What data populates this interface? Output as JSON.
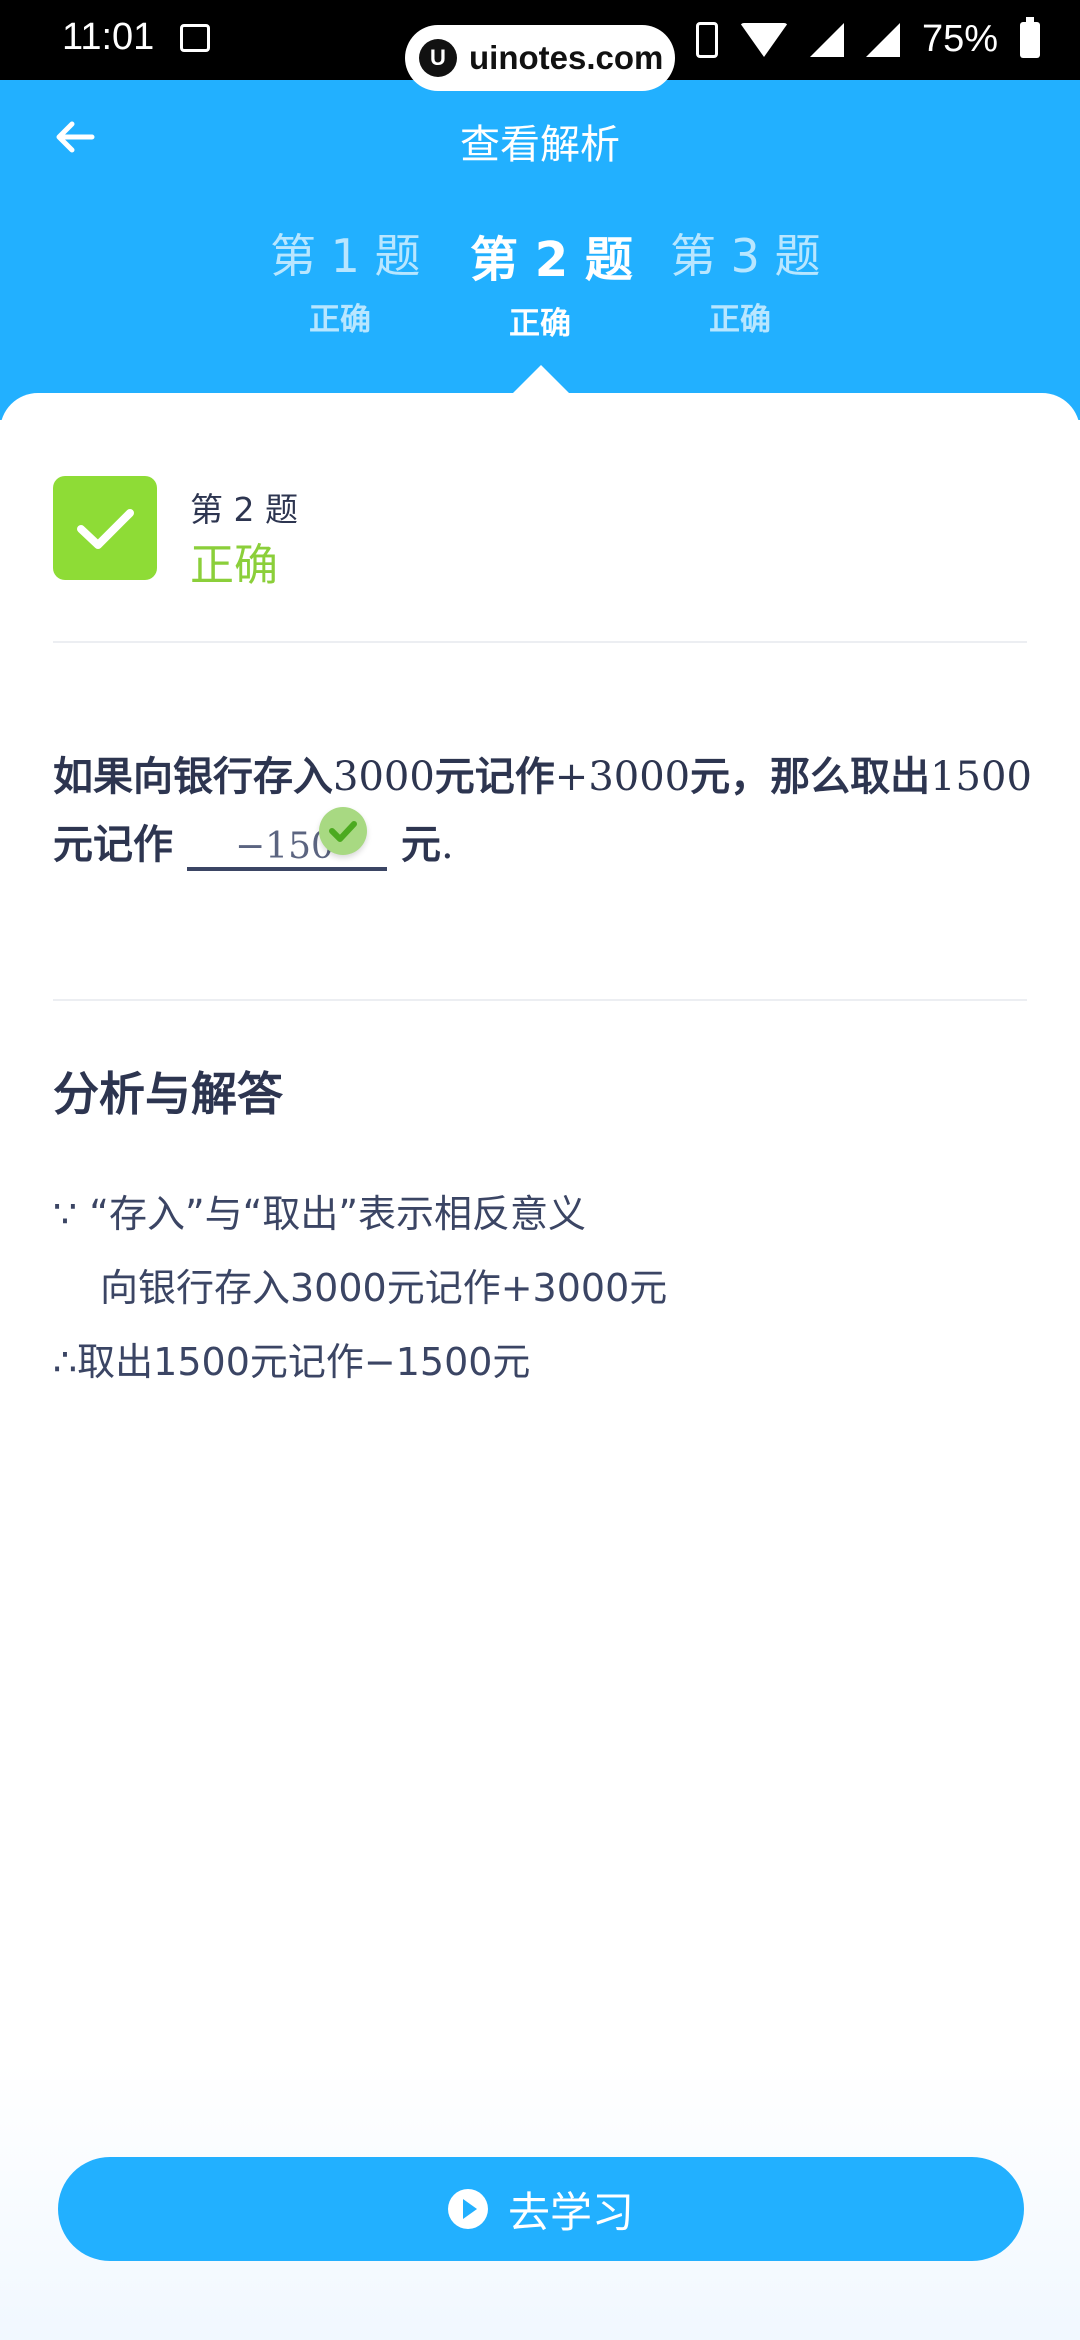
{
  "status_bar": {
    "time": "11:01",
    "battery": "75%"
  },
  "watermark": {
    "text": "uinotes.com"
  },
  "header": {
    "title": "查看解析"
  },
  "tabs": [
    {
      "label": "第 1 题",
      "status": "正确"
    },
    {
      "label": "第 2 题",
      "status": "正确"
    },
    {
      "label": "第 3 题",
      "status": "正确"
    }
  ],
  "result": {
    "question_no": "第 2 题",
    "state": "正确"
  },
  "question": {
    "part1": "如果向银行存入",
    "n1": "3000",
    "part2": "元记作",
    "n2": "+3000",
    "part3": "元，那么取出",
    "n3": "1500",
    "part4": "元记作",
    "answer": "−150",
    "part5": "元",
    "end": "."
  },
  "analysis": {
    "title": "分析与解答",
    "lines": [
      "∵ “存入”与“取出”表示相反意义",
      "向银行存入3000元记作+3000元",
      "∴取出1500元记作−1500元"
    ]
  },
  "study_button": {
    "label": "去学习"
  }
}
